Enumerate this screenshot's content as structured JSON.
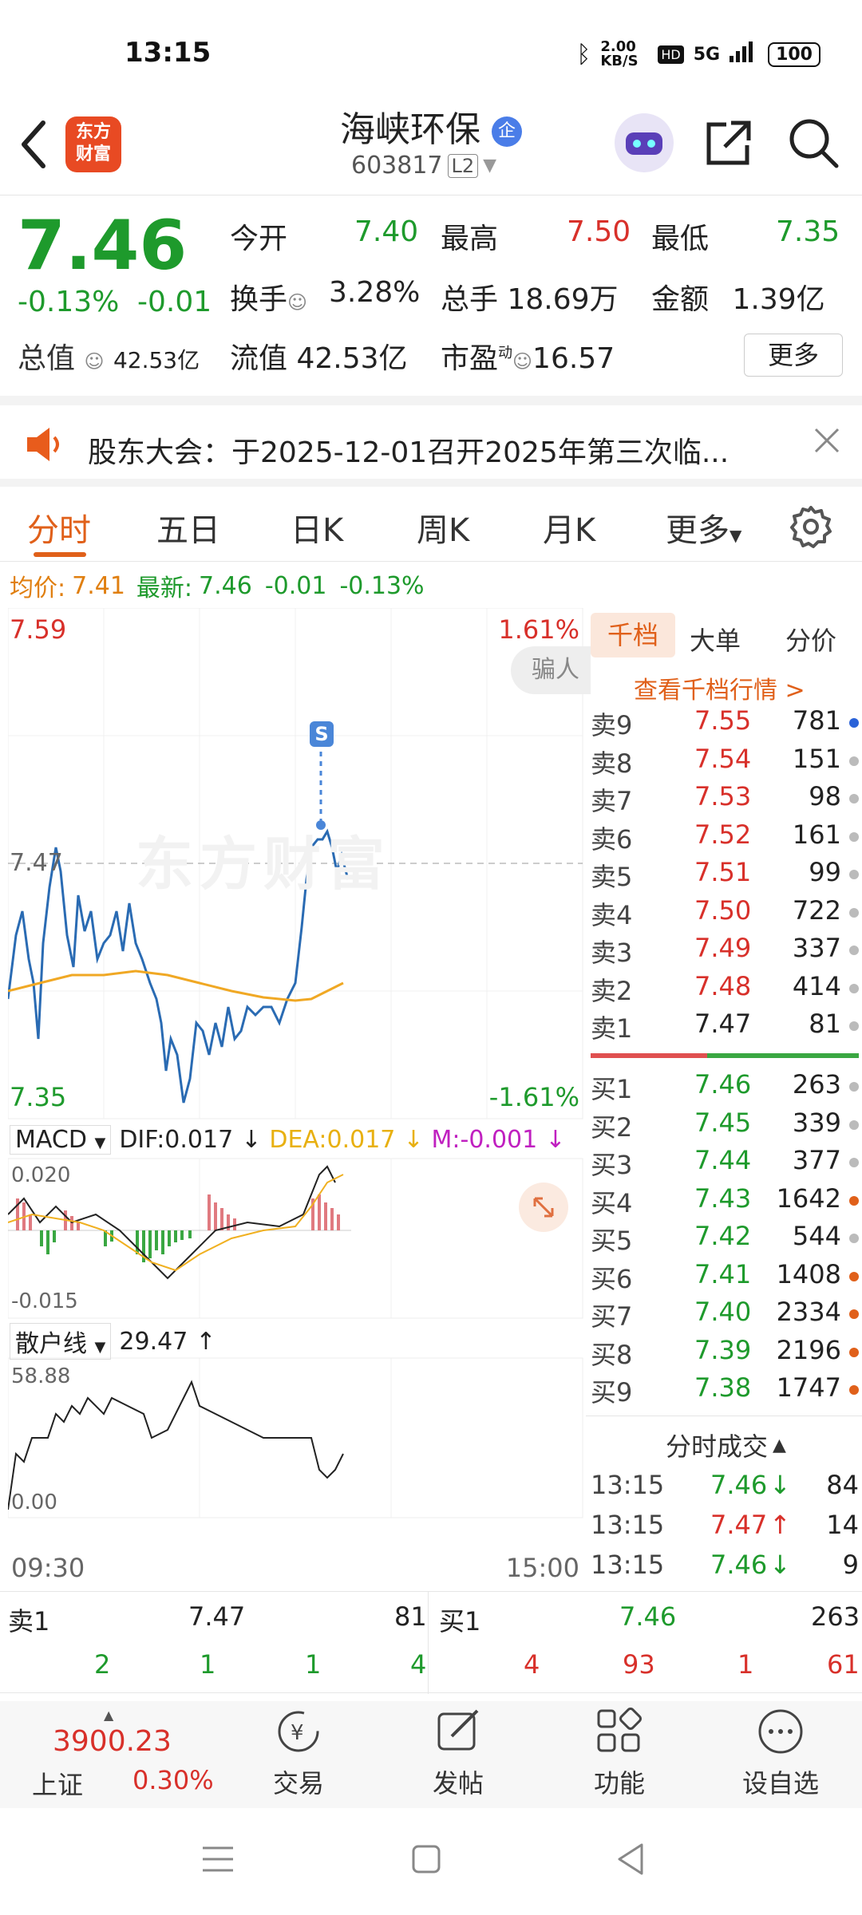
{
  "status": {
    "time": "13:15",
    "net_speed": "2.00 KB/S",
    "network": "5G",
    "battery": "100"
  },
  "header": {
    "logo_line1": "东方",
    "logo_line2": "财富",
    "stock_name": "海峡环保",
    "badge": "企",
    "stock_code": "603817",
    "level": "L2"
  },
  "quote": {
    "price": "7.46",
    "change_pct": "-0.13%",
    "change": "-0.01",
    "open_label": "今开",
    "open": "7.40",
    "high_label": "最高",
    "high": "7.50",
    "low_label": "最低",
    "low": "7.35",
    "turnover_label": "换手",
    "turnover": "3.28%",
    "volume_label": "总手",
    "volume": "18.69万",
    "amount_label": "金额",
    "amount": "1.39亿",
    "mktcap_label": "总值",
    "mktcap": "42.53亿",
    "float_label": "流值",
    "float": "42.53亿",
    "pe_label": "市盈",
    "pe_sup": "动",
    "pe": "16.57",
    "more": "更多"
  },
  "notice": {
    "text": "股东大会：于2025-12-01召开2025年第三次临..."
  },
  "tabs": [
    "分时",
    "五日",
    "日K",
    "周K",
    "月K",
    "更多"
  ],
  "avg": {
    "avg_label": "均价:",
    "avg": "7.41",
    "latest_label": "最新:",
    "latest": "7.46",
    "chg": "-0.01",
    "pct": "-0.13%"
  },
  "chart": {
    "max_price": "7.59",
    "max_pct": "1.61%",
    "min_price": "7.35",
    "min_pct": "-1.61%",
    "ref_line": "7.47",
    "watermark": "东方财富",
    "start_time": "09:30",
    "end_time": "15:00",
    "tag": "骗人",
    "signal": "S",
    "macd_label": "MACD",
    "dif": "DIF:0.017",
    "dea": "DEA:0.017",
    "m": "M:-0.001",
    "macd_max": "0.020",
    "macd_min": "-0.015",
    "retail_label": "散户线",
    "retail_val": "29.47",
    "retail_max": "58.88",
    "retail_min": "0.00"
  },
  "book": {
    "tabs": [
      "千档",
      "大单",
      "分价"
    ],
    "link": "查看千档行情 >",
    "asks": [
      {
        "name": "卖9",
        "price": "7.55",
        "vol": "781",
        "dot": "#2a62d8"
      },
      {
        "name": "卖8",
        "price": "7.54",
        "vol": "151",
        "dot": "#bbbbbb"
      },
      {
        "name": "卖7",
        "price": "7.53",
        "vol": "98",
        "dot": "#bbbbbb"
      },
      {
        "name": "卖6",
        "price": "7.52",
        "vol": "161",
        "dot": "#bbbbbb"
      },
      {
        "name": "卖5",
        "price": "7.51",
        "vol": "99",
        "dot": "#bbbbbb"
      },
      {
        "name": "卖4",
        "price": "7.50",
        "vol": "722",
        "dot": "#bbbbbb"
      },
      {
        "name": "卖3",
        "price": "7.49",
        "vol": "337",
        "dot": "#bbbbbb"
      },
      {
        "name": "卖2",
        "price": "7.48",
        "vol": "414",
        "dot": "#bbbbbb"
      },
      {
        "name": "卖1",
        "price": "7.47",
        "vol": "81",
        "dot": "#bbbbbb"
      }
    ],
    "bids": [
      {
        "name": "买1",
        "price": "7.46",
        "vol": "263",
        "dot": "#bbbbbb"
      },
      {
        "name": "买2",
        "price": "7.45",
        "vol": "339",
        "dot": "#bbbbbb"
      },
      {
        "name": "买3",
        "price": "7.44",
        "vol": "377",
        "dot": "#bbbbbb"
      },
      {
        "name": "买4",
        "price": "7.43",
        "vol": "1642",
        "dot": "#e0601a"
      },
      {
        "name": "买5",
        "price": "7.42",
        "vol": "544",
        "dot": "#bbbbbb"
      },
      {
        "name": "买6",
        "price": "7.41",
        "vol": "1408",
        "dot": "#e0601a"
      },
      {
        "name": "买7",
        "price": "7.40",
        "vol": "2334",
        "dot": "#e0601a"
      },
      {
        "name": "买8",
        "price": "7.39",
        "vol": "2196",
        "dot": "#e0601a"
      },
      {
        "name": "买9",
        "price": "7.38",
        "vol": "1747",
        "dot": "#e0601a"
      }
    ],
    "trades_title": "分时成交",
    "trades": [
      {
        "time": "13:15",
        "price": "7.46",
        "arrow": "↓",
        "vol": "84",
        "dir": "down"
      },
      {
        "time": "13:15",
        "price": "7.47",
        "arrow": "↑",
        "vol": "14",
        "dir": "up"
      },
      {
        "time": "13:15",
        "price": "7.46",
        "arrow": "↓",
        "vol": "9",
        "dir": "down"
      }
    ]
  },
  "strip": {
    "sell_name": "卖1",
    "sell_price": "7.47",
    "sell_vol": "81",
    "buy_name": "买1",
    "buy_price": "7.46",
    "buy_vol": "263",
    "left_nums": [
      "2",
      "1",
      "1",
      "4"
    ],
    "right_nums": [
      "4",
      "93",
      "1",
      "61"
    ]
  },
  "bottomnav": {
    "index_value": "3900.23",
    "index_name": "上证",
    "index_pct": "0.30%",
    "trade": "交易",
    "post": "发帖",
    "func": "功能",
    "watch": "设自选"
  }
}
